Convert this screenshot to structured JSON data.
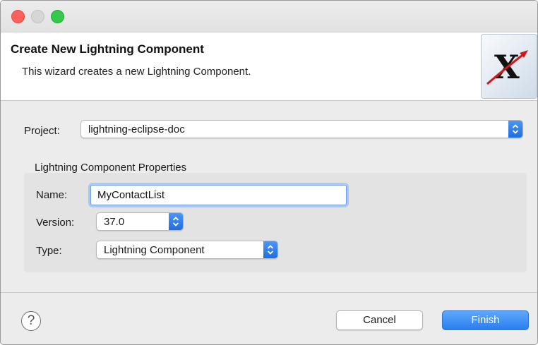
{
  "dialog": {
    "title": "Create New Lightning Component",
    "description": "This wizard creates a new Lightning Component.",
    "logo_letter": "X"
  },
  "project": {
    "label": "Project:",
    "value": "lightning-eclipse-doc"
  },
  "properties": {
    "group_title": "Lightning Component Properties",
    "name_label": "Name:",
    "name_value": "MyContactList",
    "version_label": "Version:",
    "version_value": "37.0",
    "type_label": "Type:",
    "type_value": "Lightning Component"
  },
  "footer": {
    "help_symbol": "?",
    "cancel_label": "Cancel",
    "finish_label": "Finish"
  },
  "colors": {
    "accent": "#2a7fee",
    "close_light": "#fc605c",
    "zoom_light": "#35c94a",
    "focus_ring": "#a9c8f5"
  }
}
